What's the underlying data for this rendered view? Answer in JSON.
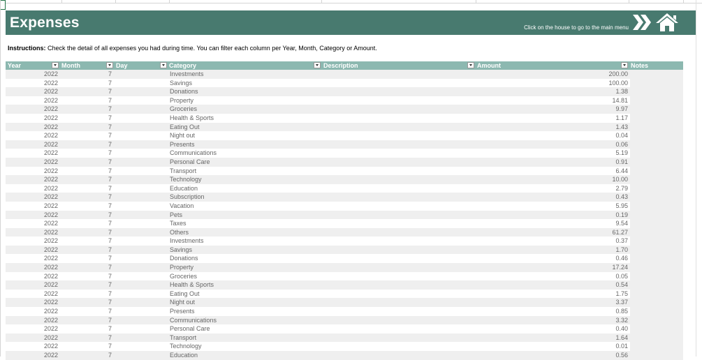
{
  "banner": {
    "title": "Expenses",
    "hint": "Click on the house to go to the main menu"
  },
  "instructions": {
    "label": "Instructions:",
    "text": " Check the detail of all expenses you had during time. You can filter each column per Year, Month, Category or Amount."
  },
  "columns": [
    "Year",
    "Month",
    "Day",
    "Category",
    "Description",
    "Amount",
    "Notes"
  ],
  "rows": [
    [
      "2022",
      "7",
      "Investments",
      "200.00"
    ],
    [
      "2022",
      "7",
      "Savings",
      "100.00"
    ],
    [
      "2022",
      "7",
      "Donations",
      "1.38"
    ],
    [
      "2022",
      "7",
      "Property",
      "14.81"
    ],
    [
      "2022",
      "7",
      "Groceries",
      "9.97"
    ],
    [
      "2022",
      "7",
      "Health & Sports",
      "1.17"
    ],
    [
      "2022",
      "7",
      "Eating Out",
      "1.43"
    ],
    [
      "2022",
      "7",
      "Night out",
      "0.04"
    ],
    [
      "2022",
      "7",
      "Presents",
      "0.06"
    ],
    [
      "2022",
      "7",
      "Communications",
      "5.19"
    ],
    [
      "2022",
      "7",
      "Personal Care",
      "0.91"
    ],
    [
      "2022",
      "7",
      "Transport",
      "6.44"
    ],
    [
      "2022",
      "7",
      "Technology",
      "10.00"
    ],
    [
      "2022",
      "7",
      "Education",
      "2.79"
    ],
    [
      "2022",
      "7",
      "Subscription",
      "0.43"
    ],
    [
      "2022",
      "7",
      "Vacation",
      "5.95"
    ],
    [
      "2022",
      "7",
      "Pets",
      "0.19"
    ],
    [
      "2022",
      "7",
      "Taxes",
      "9.54"
    ],
    [
      "2022",
      "7",
      "Others",
      "61.27"
    ],
    [
      "2022",
      "7",
      "Investments",
      "0.37"
    ],
    [
      "2022",
      "7",
      "Savings",
      "1.70"
    ],
    [
      "2022",
      "7",
      "Donations",
      "0.46"
    ],
    [
      "2022",
      "7",
      "Property",
      "17.24"
    ],
    [
      "2022",
      "7",
      "Groceries",
      "0.05"
    ],
    [
      "2022",
      "7",
      "Health & Sports",
      "0.54"
    ],
    [
      "2022",
      "7",
      "Eating Out",
      "1.75"
    ],
    [
      "2022",
      "7",
      "Night out",
      "3.37"
    ],
    [
      "2022",
      "7",
      "Presents",
      "0.85"
    ],
    [
      "2022",
      "7",
      "Communications",
      "3.32"
    ],
    [
      "2022",
      "7",
      "Personal Care",
      "0.40"
    ],
    [
      "2022",
      "7",
      "Transport",
      "1.64"
    ],
    [
      "2022",
      "7",
      "Technology",
      "0.01"
    ],
    [
      "2022",
      "7",
      "Education",
      "0.56"
    ]
  ],
  "colors": {
    "banner": "#487a6f",
    "header": "#8cb8b0",
    "stripe": "#efefef"
  },
  "icons": {
    "forward": "double-chevron-icon",
    "home": "house-icon"
  }
}
